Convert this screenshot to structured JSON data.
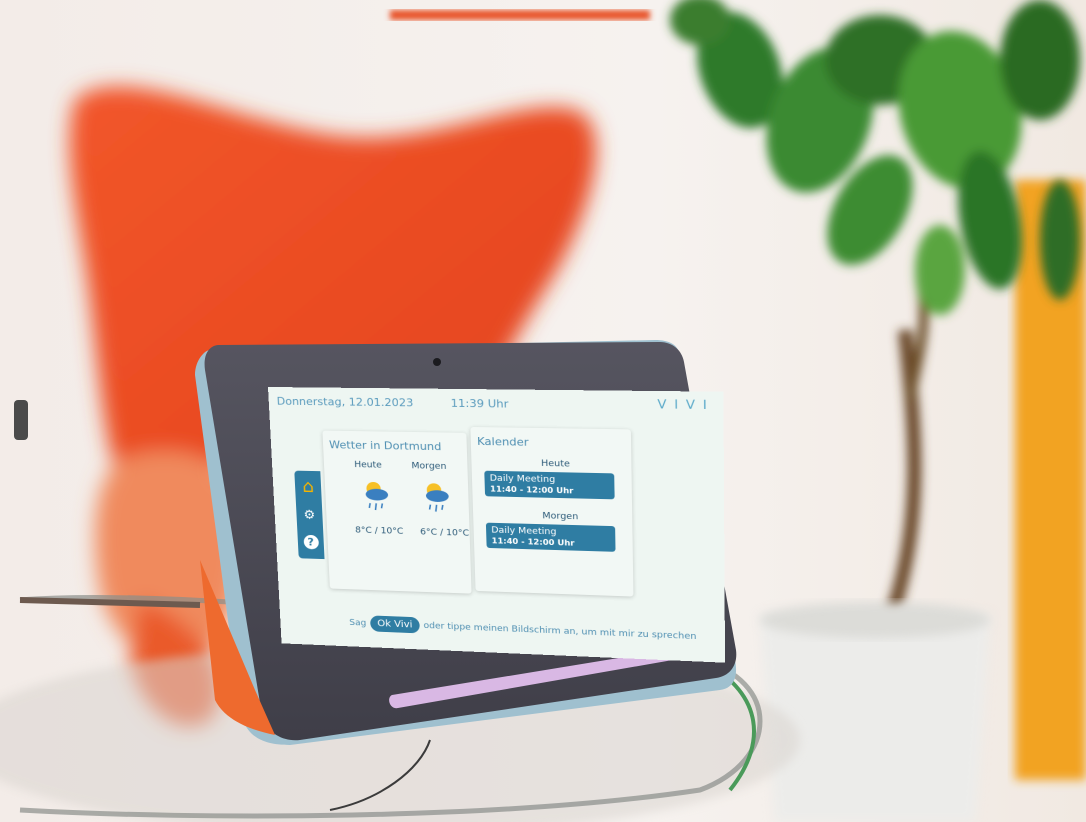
{
  "screen": {
    "date": "Donnerstag, 12.01.2023",
    "time": "11:39 Uhr",
    "brand": "VIVI"
  },
  "weather": {
    "title": "Wetter in Dortmund",
    "today_label": "Heute",
    "tomorrow_label": "Morgen",
    "today_temp": "8°C / 10°C",
    "tomorrow_temp": "6°C / 10°C"
  },
  "calendar": {
    "title": "Kalender",
    "today_label": "Heute",
    "tomorrow_label": "Morgen",
    "events": [
      {
        "title": "Daily Meeting",
        "time": "11:40 - 12:00 Uhr"
      },
      {
        "title": "Daily Meeting",
        "time": "11:40 - 12:00 Uhr"
      }
    ]
  },
  "hint": {
    "prefix": "Sag",
    "wake_word": "Ok Vivi",
    "suffix": "oder tippe meinen Bildschirm an, um mit mir zu sprechen"
  },
  "icons": {
    "home": "home-icon",
    "settings": "settings-icon",
    "help": "help-icon",
    "weather": "rain-cloud-sun-icon"
  },
  "colors": {
    "accent": "#2f7da3",
    "home_icon": "#f4b400",
    "screen_bg": "#eef6f2"
  }
}
